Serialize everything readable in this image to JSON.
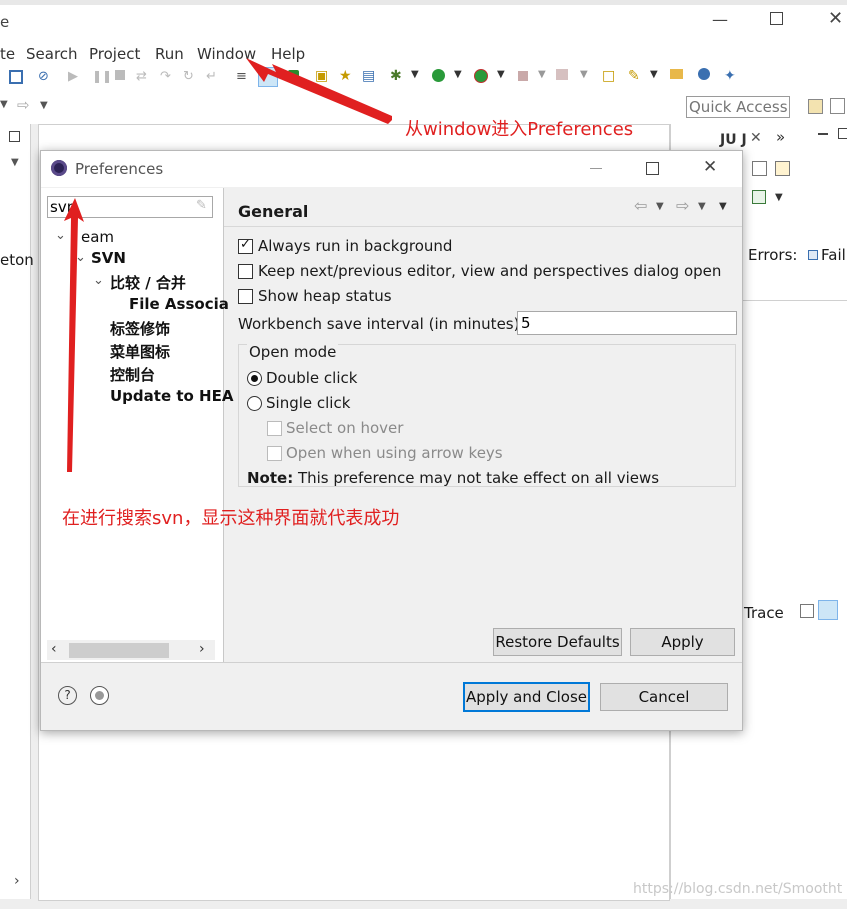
{
  "menu": {
    "partial_left": "te",
    "items": [
      "Search",
      "Project",
      "Run",
      "Window",
      "Help"
    ]
  },
  "quick_access": {
    "placeholder": "Quick Access"
  },
  "background_view": {
    "left_text": "eton",
    "tab_label": "JU J",
    "errors_label": "Errors:",
    "failures_label": "Failu",
    "trace_label": "e Trace",
    "watermark": "https://blog.csdn.net/Smootht"
  },
  "annotations": {
    "top_note": "从window进入Preferences",
    "bottom_note": "在进行搜索svn，显示这种界面就代表成功"
  },
  "dialog": {
    "title": "Preferences",
    "search": {
      "value": "svn"
    },
    "tree": [
      {
        "label": "Team",
        "display": "eam",
        "expanded": true
      },
      {
        "label": "SVN",
        "expanded": true
      },
      {
        "label": "比较 / 合并",
        "expanded": true
      },
      {
        "label": "File Associa"
      },
      {
        "label": "标签修饰"
      },
      {
        "label": "菜单图标"
      },
      {
        "label": "控制台"
      },
      {
        "label": "Update to HEA"
      }
    ],
    "page": {
      "title": "General",
      "always_run_bg": {
        "label": "Always run in background",
        "checked": true
      },
      "keep_editor": {
        "label": "Keep next/previous editor, view and perspectives dialog open",
        "checked": false
      },
      "heap_status": {
        "label": "Show heap status",
        "checked": false
      },
      "save_interval": {
        "label": "Workbench save interval (in minutes):",
        "value": "5"
      },
      "open_mode": {
        "label": "Open mode",
        "double_click": "Double click",
        "single_click": "Single click",
        "selected": "Double click",
        "select_hover": "Select on hover",
        "open_arrow": "Open when using arrow keys"
      },
      "note_bold": "Note:",
      "note_text": " This preference may not take effect on all views"
    },
    "buttons": {
      "restore": "Restore Defaults",
      "apply": "Apply",
      "apply_close": "Apply and Close",
      "cancel": "Cancel"
    }
  }
}
